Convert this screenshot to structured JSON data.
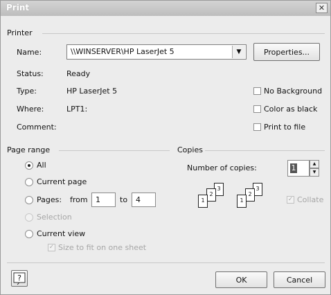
{
  "window": {
    "title": "Print",
    "close_label": "✕"
  },
  "printer": {
    "group_label": "Printer",
    "name_label": "Name:",
    "name_value": "\\\\WINSERVER\\HP LaserJet 5",
    "properties_button": "Properties...",
    "status_label": "Status:",
    "status_value": "Ready",
    "type_label": "Type:",
    "type_value": "HP LaserJet 5",
    "where_label": "Where:",
    "where_value": "LPT1:",
    "comment_label": "Comment:",
    "no_background_label": "No Background",
    "color_as_black_label": "Color as black",
    "print_to_file_label": "Print to file"
  },
  "page_range": {
    "group_label": "Page range",
    "all_label": "All",
    "current_page_label": "Current page",
    "pages_label": "Pages:",
    "from_label": "from",
    "from_value": "1",
    "to_label": "to",
    "to_value": "4",
    "selection_label": "Selection",
    "current_view_label": "Current view",
    "size_to_fit_label": "Size to fit on one sheet",
    "selected": "All"
  },
  "copies": {
    "group_label": "Copies",
    "number_label": "Number of copies:",
    "number_value": "1",
    "collate_label": "Collate",
    "collate_checked": true,
    "stack_pages": [
      "1",
      "2",
      "3"
    ]
  },
  "footer": {
    "ok_label": "OK",
    "cancel_label": "Cancel"
  }
}
